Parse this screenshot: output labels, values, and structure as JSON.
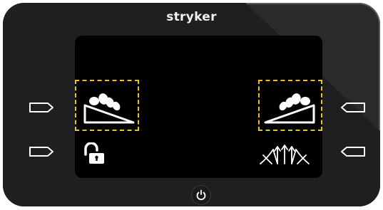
{
  "device": {
    "brand": "stryker",
    "accent_color": "#e8c21e",
    "screen_color": "#000000",
    "bezel_color": "#2a2a2c"
  },
  "screen": {
    "left_zone": {
      "icon": "head-of-bed-up-icon",
      "selected": true
    },
    "right_zone": {
      "icon": "foot-of-bed-up-icon",
      "selected": true
    },
    "lock_icon": "unlocked-padlock-icon",
    "motion_icon": "bed-motion-arrows-icon"
  },
  "buttons": {
    "left": [
      "side-button-left-top",
      "side-button-left-bottom"
    ],
    "right": [
      "side-button-right-top",
      "side-button-right-bottom"
    ],
    "power": "power-icon"
  }
}
